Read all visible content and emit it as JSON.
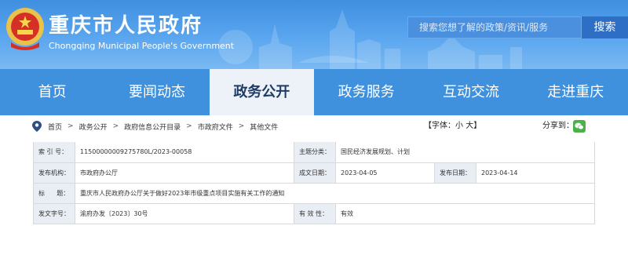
{
  "header": {
    "title": "重庆市人民政府",
    "subtitle": "Chongqing Municipal People's Government",
    "search_placeholder": "搜索您想了解的政策/资讯/服务",
    "search_button": "搜索"
  },
  "nav": {
    "items": [
      "首页",
      "要闻动态",
      "政务公开",
      "政务服务",
      "互动交流",
      "走进重庆"
    ],
    "active_index": 2
  },
  "breadcrumb": {
    "items": [
      "首页",
      "政务公开",
      "政府信息公开目录",
      "市政府文件",
      "其他文件"
    ],
    "separator": ">"
  },
  "font_size": {
    "label_open": "【字体：",
    "small": "小",
    "large": "大",
    "label_close": "】"
  },
  "share": {
    "label": "分享到："
  },
  "info": {
    "index_label": "索 引 号：",
    "index_value": "11500000009275780L/2023-00058",
    "topic_label": "主题分类：",
    "topic_value": "国民经济发展规划、计划",
    "issuer_label": "发布机构：",
    "issuer_value": "市政府办公厅",
    "created_label": "成文日期：",
    "created_value": "2023-04-05",
    "published_label": "发布日期：",
    "published_value": "2023-04-14",
    "title_label": "标      题：",
    "title_value": "重庆市人民政府办公厅关于做好2023年市级重点项目实施有关工作的通知",
    "docno_label": "发文字号：",
    "docno_value": "渝府办发〔2023〕30号",
    "validity_label": "有 效 性：",
    "validity_value": "有效"
  },
  "colors": {
    "banner": "#4a9ae6",
    "nav": "#3f90dd",
    "nav_active_bg": "#edf2f8",
    "label_bg": "#e9eef5",
    "wechat": "#4cb04b"
  }
}
